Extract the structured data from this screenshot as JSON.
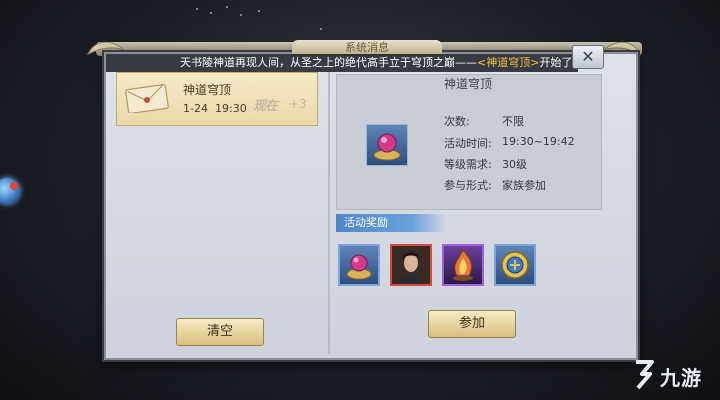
{
  "window": {
    "title": "系统消息",
    "close_label": "✕"
  },
  "marquee": {
    "text_before": "天书陵神道再现人间，从圣之上的绝代高手立于穹顶之巅——",
    "highlight": "<神道穹顶>",
    "text_after": "开始了"
  },
  "activity_list": [
    {
      "title": "神道穹顶",
      "date": "1-24",
      "time": "19:30",
      "mark": "现在",
      "plus": "+3"
    }
  ],
  "buttons": {
    "clear": "清空",
    "join": "参加"
  },
  "detail": {
    "title": "神道穹顶",
    "rows": [
      {
        "label": "次数:",
        "value": "不限"
      },
      {
        "label": "活动时间:",
        "value": "19:30~19:42"
      },
      {
        "label": "等级需求:",
        "value": "30级"
      },
      {
        "label": "参与形式:",
        "value": "家族参加"
      }
    ]
  },
  "rewards": {
    "header": "活动奖励",
    "items": [
      {
        "icon": "gem-pedestal-icon",
        "rarity": "blue"
      },
      {
        "icon": "character-portrait-icon",
        "rarity": "red"
      },
      {
        "icon": "flame-crystal-icon",
        "rarity": "purple"
      },
      {
        "icon": "jade-token-icon",
        "rarity": "blue"
      }
    ]
  },
  "watermark": {
    "text": "九游"
  },
  "colors": {
    "highlight": "#f0c23c",
    "reward_header": "#4f86c6",
    "button_gold": "#d8bf7c"
  }
}
